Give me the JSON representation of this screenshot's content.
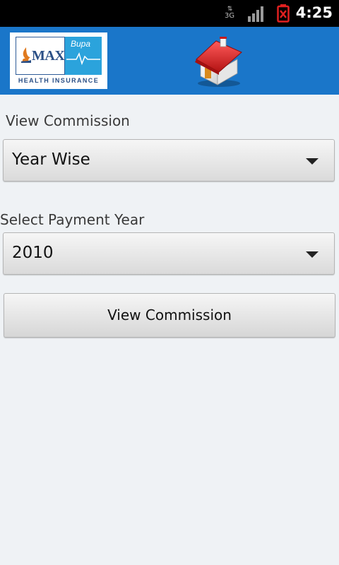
{
  "status_bar": {
    "network_type": "3G",
    "time": "4:25",
    "icons": [
      "data-arrows-icon",
      "signal-strength-icon",
      "battery-alert-icon"
    ]
  },
  "header": {
    "logo": {
      "brand": "MAX",
      "partner": "Bupa",
      "tagline": "HEALTH INSURANCE"
    },
    "home_icon": "home-icon"
  },
  "form": {
    "view_label": "View Commission",
    "view_selected": "Year Wise",
    "year_label": "Select Payment Year",
    "year_selected": "2010",
    "submit_label": "View Commission"
  },
  "colors": {
    "header_bg": "#1a76c9",
    "page_bg": "#eff2f5",
    "status_bg": "#000000"
  }
}
